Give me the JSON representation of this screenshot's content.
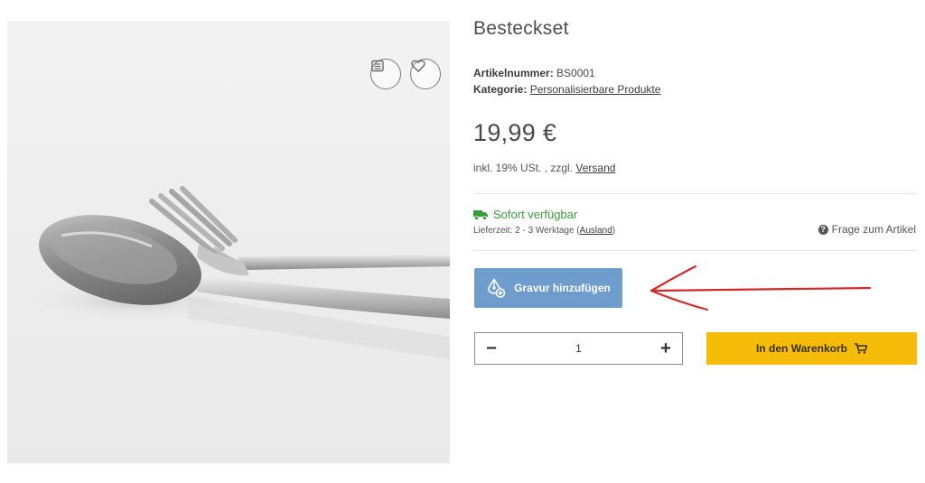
{
  "product": {
    "title": "Besteckset",
    "article_label": "Artikelnummer:",
    "article_number": "BS0001",
    "category_label": "Kategorie:",
    "category_value": "Personalisierbare Produkte",
    "price": "19,99 €",
    "tax_text": "inkl. 19% USt. , zzgl.",
    "shipping_link": "Versand"
  },
  "availability": {
    "status": "Sofort verfügbar",
    "delivery_prefix": "Lieferzeit: 2 - 3 Werktage (",
    "delivery_link": "Ausland",
    "delivery_suffix": ")",
    "status_color": "#3a9b3a"
  },
  "question": {
    "label": "Frage zum Artikel"
  },
  "engraving": {
    "label": "Gravur hinzufügen",
    "color": "#6e9ccd"
  },
  "quantity": {
    "minus": "−",
    "value": "1",
    "plus": "+"
  },
  "cart": {
    "label": "In den Warenkorb",
    "color": "#f5bd0a"
  },
  "image_actions": {
    "compare_icon": "list-icon",
    "wishlist_icon": "heart-icon"
  },
  "annotation": {
    "arrow_color": "#d42a2a"
  }
}
